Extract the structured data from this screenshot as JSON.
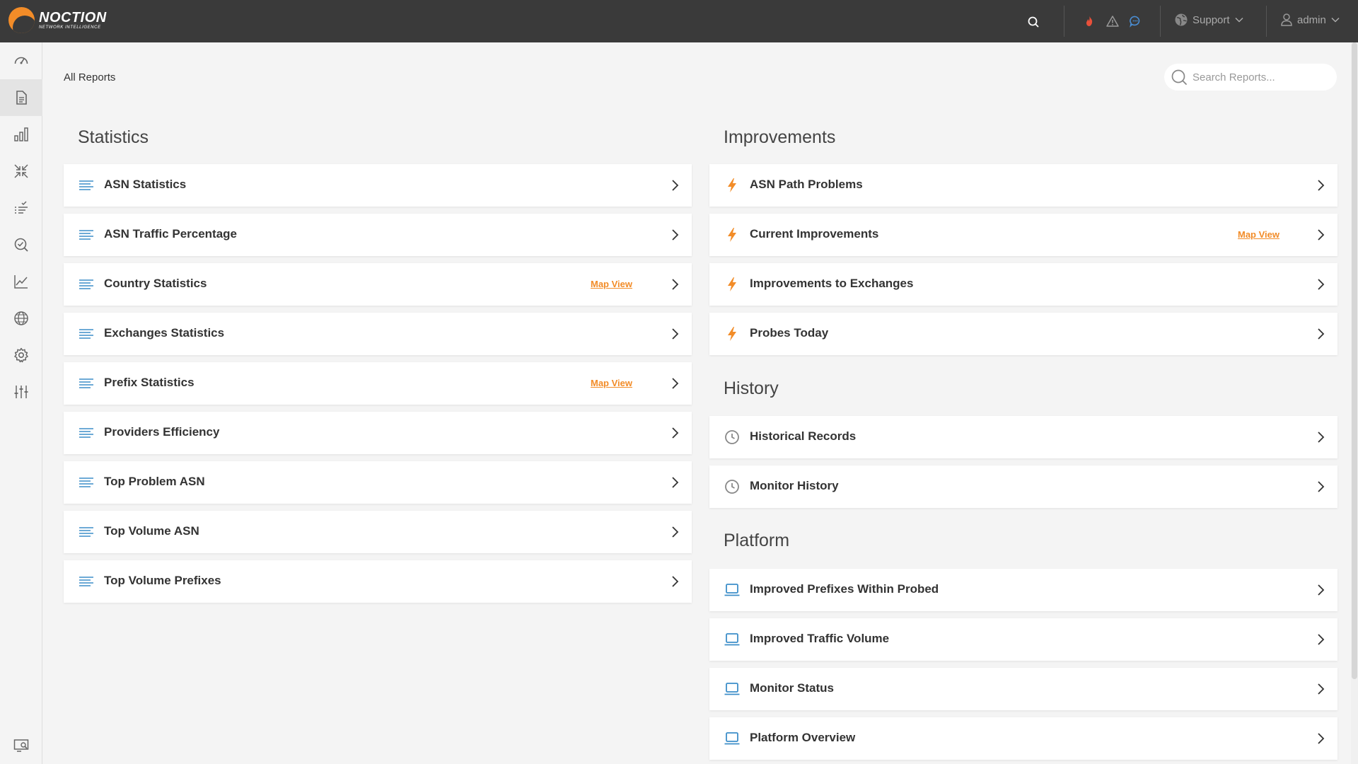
{
  "brand": {
    "name": "NOCTION",
    "tagline": "NETWORK INTELLIGENCE"
  },
  "header": {
    "support_label": "Support",
    "user_label": "admin",
    "icons": [
      "search-icon",
      "fire-icon",
      "warning-icon",
      "chat-icon",
      "globe-icon",
      "user-icon"
    ]
  },
  "sidebar": {
    "items": [
      "dashboard-icon",
      "reports-icon",
      "bar-chart-icon",
      "compress-icon",
      "checklist-icon",
      "inspect-icon",
      "line-chart-icon",
      "globe-icon",
      "settings-icon",
      "sliders-icon",
      "monitor-search-icon"
    ],
    "active_index": 1
  },
  "breadcrumb": "All Reports",
  "search": {
    "placeholder": "Search Reports..."
  },
  "sections": {
    "statistics": {
      "title": "Statistics",
      "items": [
        {
          "label": "ASN Statistics",
          "map_view": ""
        },
        {
          "label": "ASN Traffic Percentage",
          "map_view": ""
        },
        {
          "label": "Country Statistics",
          "map_view": "Map View"
        },
        {
          "label": "Exchanges Statistics",
          "map_view": ""
        },
        {
          "label": "Prefix Statistics",
          "map_view": "Map View"
        },
        {
          "label": "Providers Efficiency",
          "map_view": ""
        },
        {
          "label": "Top Problem ASN",
          "map_view": ""
        },
        {
          "label": "Top Volume ASN",
          "map_view": ""
        },
        {
          "label": "Top Volume Prefixes",
          "map_view": ""
        }
      ]
    },
    "improvements": {
      "title": "Improvements",
      "items": [
        {
          "label": "ASN Path Problems",
          "map_view": ""
        },
        {
          "label": "Current Improvements",
          "map_view": "Map View"
        },
        {
          "label": "Improvements to Exchanges",
          "map_view": ""
        },
        {
          "label": "Probes Today",
          "map_view": ""
        }
      ]
    },
    "history": {
      "title": "History",
      "items": [
        {
          "label": "Historical Records"
        },
        {
          "label": "Monitor History"
        }
      ]
    },
    "platform": {
      "title": "Platform",
      "items": [
        {
          "label": "Improved Prefixes Within Probed"
        },
        {
          "label": "Improved Traffic Volume"
        },
        {
          "label": "Monitor Status"
        },
        {
          "label": "Platform Overview"
        }
      ]
    }
  },
  "colors": {
    "accent": "#f28c28",
    "report_icon": "#3d8ec9",
    "topbar": "#3a3a3a"
  }
}
